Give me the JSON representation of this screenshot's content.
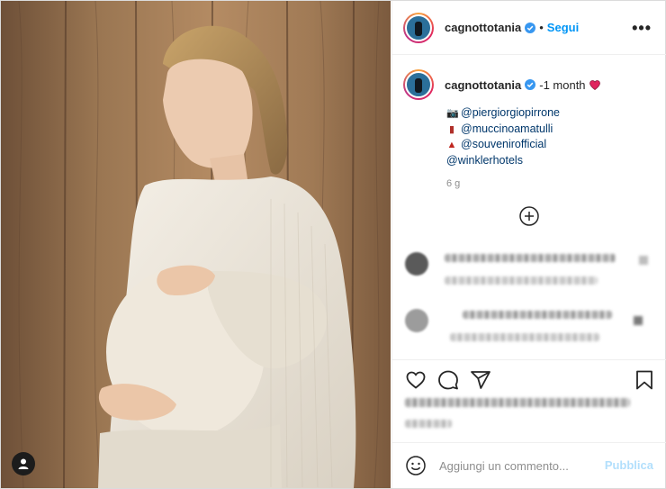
{
  "header": {
    "username": "cagnottotania",
    "separator": "•",
    "follow_label": "Segui",
    "more_label": "•••"
  },
  "caption": {
    "username": "cagnottotania",
    "time_inline": "-1 month",
    "lines": [
      {
        "emoji": "camera",
        "text": "@piergiorgiopirrone"
      },
      {
        "emoji": "bottle",
        "text": "@muccinoamatulli"
      },
      {
        "emoji": "dress",
        "text": "@souvenirofficial"
      },
      {
        "emoji": "",
        "text": "@winklerhotels"
      }
    ],
    "age": "6 g"
  },
  "comment_box": {
    "placeholder": "Aggiungi un commento...",
    "publish_label": "Pubblica"
  },
  "icons": {
    "verified": "verified-badge-icon",
    "like": "heart-icon",
    "comment": "comment-icon",
    "share": "paper-plane-icon",
    "save": "bookmark-icon",
    "emoji": "smiley-icon",
    "load_more": "plus-circle-icon",
    "user_tag": "user-silhouette-icon"
  },
  "colors": {
    "accent": "#0095f6",
    "mention": "#00376b",
    "publish_disabled": "#b2dffc",
    "secondary_text": "#8e8e8e"
  }
}
